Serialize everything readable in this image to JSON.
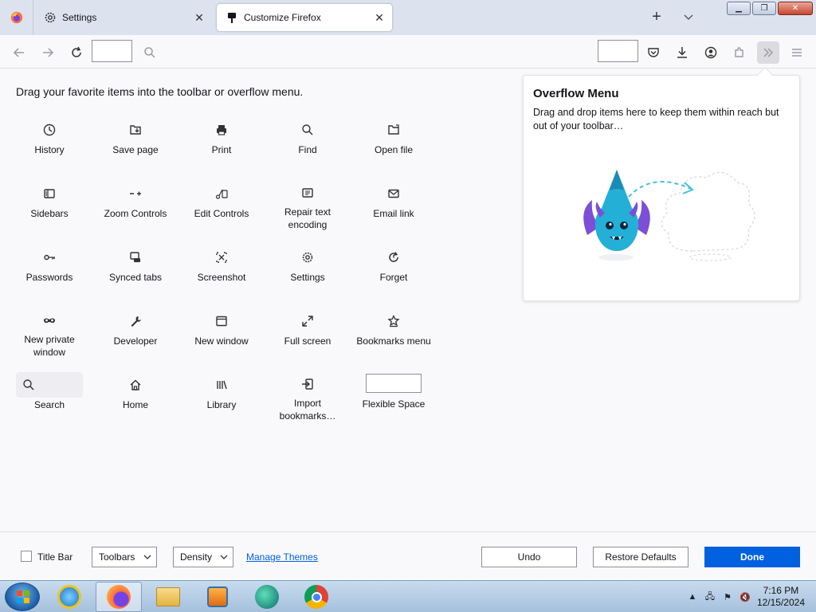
{
  "browser": {
    "tabs": [
      {
        "label": "Settings"
      },
      {
        "label": "Customize Firefox"
      }
    ]
  },
  "palette": {
    "heading": "Drag your favorite items into the toolbar or overflow menu.",
    "items": [
      {
        "label": "History",
        "icon": "clock-icon"
      },
      {
        "label": "Save page",
        "icon": "save-page-icon"
      },
      {
        "label": "Print",
        "icon": "printer-icon"
      },
      {
        "label": "Find",
        "icon": "search-icon"
      },
      {
        "label": "Open file",
        "icon": "folder-icon"
      },
      {
        "label": "Sidebars",
        "icon": "sidebar-icon"
      },
      {
        "label": "Zoom Controls",
        "icon": "zoom-icon"
      },
      {
        "label": "Edit Controls",
        "icon": "edit-icon"
      },
      {
        "label": "Repair text encoding",
        "icon": "encoding-icon"
      },
      {
        "label": "Email link",
        "icon": "mail-icon"
      },
      {
        "label": "Passwords",
        "icon": "key-icon"
      },
      {
        "label": "Synced tabs",
        "icon": "synced-tabs-icon"
      },
      {
        "label": "Screenshot",
        "icon": "screenshot-icon"
      },
      {
        "label": "Settings",
        "icon": "gear-icon"
      },
      {
        "label": "Forget",
        "icon": "forget-icon"
      },
      {
        "label": "New private window",
        "icon": "private-mask-icon"
      },
      {
        "label": "Developer",
        "icon": "wrench-icon"
      },
      {
        "label": "New window",
        "icon": "window-icon"
      },
      {
        "label": "Full screen",
        "icon": "fullscreen-icon"
      },
      {
        "label": "Bookmarks menu",
        "icon": "bookmark-star-icon"
      },
      {
        "label": "Search",
        "icon": "search-icon"
      },
      {
        "label": "Home",
        "icon": "home-icon"
      },
      {
        "label": "Library",
        "icon": "library-icon"
      },
      {
        "label": "Import bookmarks…",
        "icon": "import-icon"
      },
      {
        "label": "Flexible Space",
        "icon": "flexible-space"
      }
    ]
  },
  "overflow": {
    "title": "Overflow Menu",
    "description": "Drag and drop items here to keep them within reach but out of your toolbar…"
  },
  "bottom": {
    "title_bar": "Title Bar",
    "toolbars": "Toolbars",
    "density": "Density",
    "manage_themes": "Manage Themes",
    "undo": "Undo",
    "restore": "Restore Defaults",
    "done": "Done"
  },
  "taskbar": {
    "time": "7:16 PM",
    "date": "12/15/2024"
  },
  "colors": {
    "accent": "#0061e0",
    "link": "#0061e0",
    "mascot": "#24b0d6"
  }
}
